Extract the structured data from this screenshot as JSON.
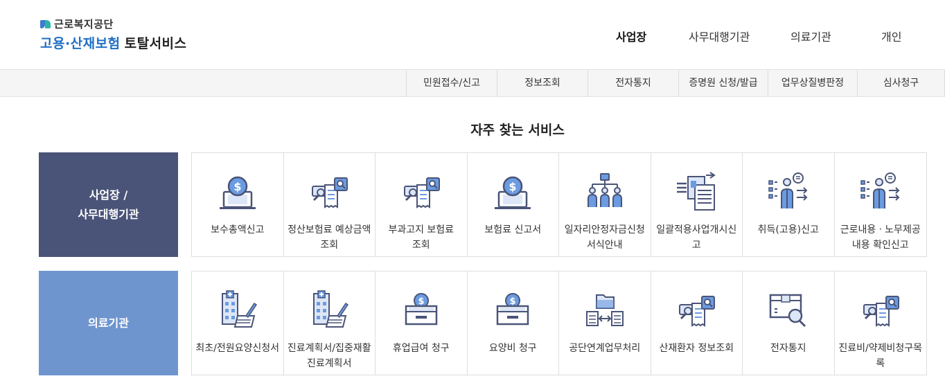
{
  "brand": {
    "org": "근로복지공단",
    "title_blue": "고용·산재보험",
    "title_dark": "토탈서비스"
  },
  "topnav": [
    "사업장",
    "사무대행기관",
    "의료기관",
    "개인"
  ],
  "subnav": [
    "민원접수/신고",
    "정보조회",
    "전자통지",
    "증명원 신청/발급",
    "업무상질병판정",
    "심사청구"
  ],
  "section_title": "자주 찾는 서비스",
  "categories": [
    {
      "label_line1": "사업장 /",
      "label_line2": "사무대행기관",
      "color": "#4a5478",
      "items": [
        {
          "label": "보수총액신고",
          "icon": "money-bag-laptop-icon"
        },
        {
          "label": "정산보험료 예상금액 조회",
          "icon": "document-search-icon"
        },
        {
          "label": "부과고지 보험료 조회",
          "icon": "document-search-icon"
        },
        {
          "label": "보험료 신고서",
          "icon": "money-bag-laptop-icon"
        },
        {
          "label": "일자리안정자금신청서식안내",
          "icon": "org-people-icon"
        },
        {
          "label": "일괄적용사업개시신고",
          "icon": "document-transfer-icon"
        },
        {
          "label": "취득(고용)신고",
          "icon": "person-presenting-icon"
        },
        {
          "label": "근로내용ㆍ노무제공내용 확인신고",
          "icon": "person-presenting-icon"
        }
      ]
    },
    {
      "label_line1": "의료기관",
      "label_line2": "",
      "color": "#6f95cf",
      "items": [
        {
          "label": "최초/전원요양신청서",
          "icon": "hospital-document-icon"
        },
        {
          "label": "진료계획서/집중재활진료계획서",
          "icon": "hospital-document-icon"
        },
        {
          "label": "휴업급여 청구",
          "icon": "coin-box-icon"
        },
        {
          "label": "요양비 청구",
          "icon": "coin-box-icon"
        },
        {
          "label": "공단연계업무처리",
          "icon": "folder-transfer-icon"
        },
        {
          "label": "산재환자 정보조회",
          "icon": "document-search-icon"
        },
        {
          "label": "전자통지",
          "icon": "box-search-icon"
        },
        {
          "label": "진료비/약제비청구목록",
          "icon": "document-search-icon"
        }
      ]
    }
  ]
}
